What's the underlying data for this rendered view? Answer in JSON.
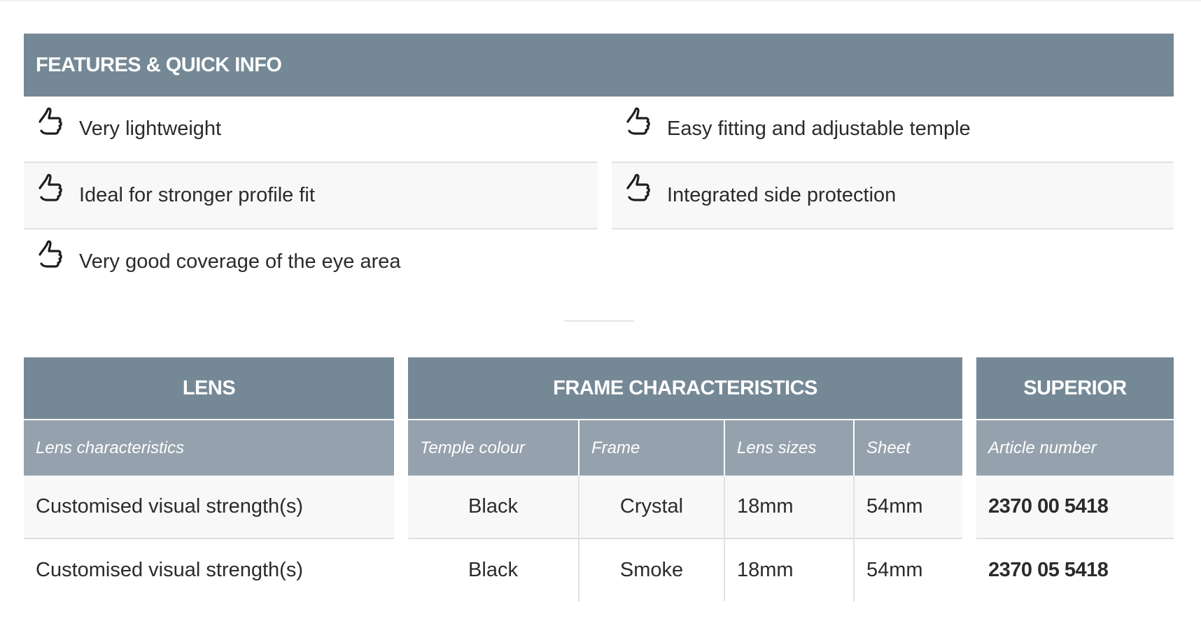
{
  "features": {
    "title": "FEATURES & QUICK INFO",
    "items": [
      {
        "text": "Very lightweight",
        "icon": "thumbs-up-icon"
      },
      {
        "text": "Easy fitting and adjustable temple",
        "icon": "thumbs-up-icon"
      },
      {
        "text": "Ideal for stronger profile fit",
        "icon": "thumbs-up-icon"
      },
      {
        "text": "Integrated side protection",
        "icon": "thumbs-up-icon"
      },
      {
        "text": "Very good coverage of the eye area",
        "icon": "thumbs-up-icon"
      }
    ]
  },
  "lens_table": {
    "title": "LENS",
    "column": "Lens characteristics",
    "rows": [
      "Customised visual strength(s)",
      "Customised visual strength(s)"
    ]
  },
  "frame_table": {
    "title": "FRAME CHARACTERISTICS",
    "columns": [
      "Temple colour",
      "Frame",
      "Lens sizes",
      "Sheet"
    ],
    "rows": [
      [
        "Black",
        "Crystal",
        "18mm",
        "54mm"
      ],
      [
        "Black",
        "Smoke",
        "18mm",
        "54mm"
      ]
    ]
  },
  "superior_table": {
    "title": "SUPERIOR",
    "column": "Article number",
    "rows": [
      "2370 00 5418",
      "2370 05 5418"
    ]
  },
  "colors": {
    "header_bg": "#758896",
    "subheader_bg": "#95a2ad",
    "row_shade": "#f8f8f8"
  }
}
